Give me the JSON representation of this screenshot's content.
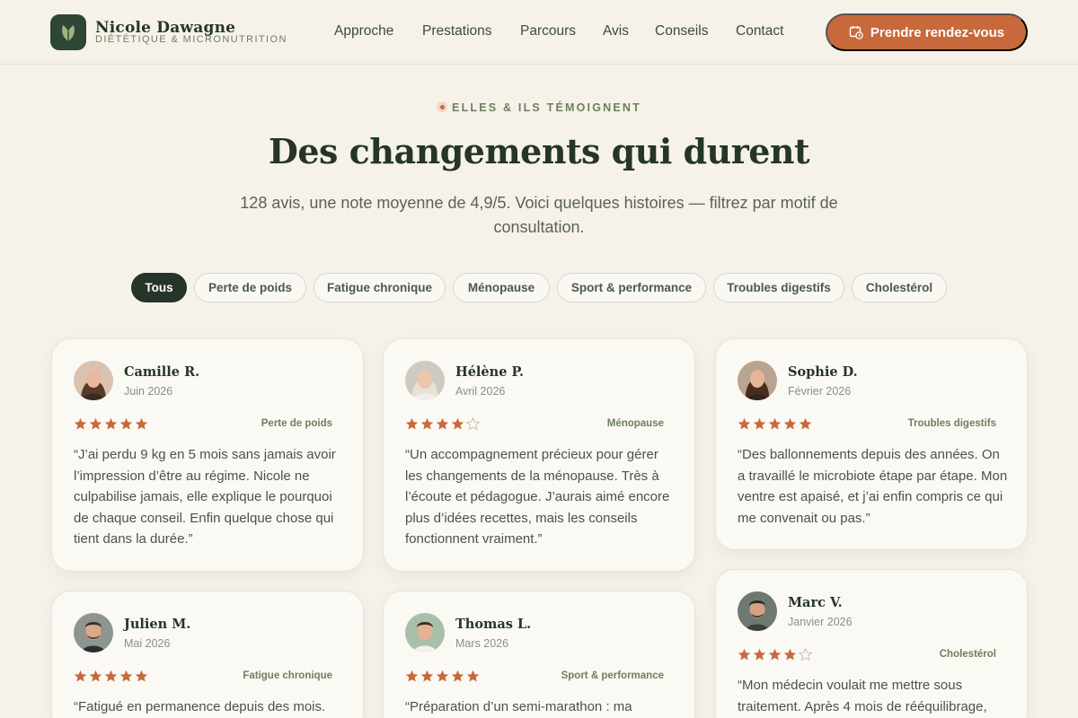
{
  "brand": {
    "name": "Nicole Dawagne",
    "tagline": "DIÉTÉTIQUE & MICRONUTRITION",
    "logo_icon": "leaf-icon"
  },
  "nav": {
    "items": [
      "Approche",
      "Prestations",
      "Parcours",
      "Avis",
      "Conseils",
      "Contact"
    ],
    "cta_label": "Prendre rendez-vous",
    "cta_icon": "calendar-clock-icon"
  },
  "hero": {
    "eyebrow": "ELLES & ILS TÉMOIGNENT",
    "title": "Des changements qui durent",
    "subtitle": "128 avis, une note moyenne de 4,9/5. Voici quelques histoires — filtrez par motif de consultation."
  },
  "filters": {
    "selected": "Tous",
    "options": [
      "Tous",
      "Perte de poids",
      "Fatigue chronique",
      "Ménopause",
      "Sport & performance",
      "Troubles digestifs",
      "Cholestérol"
    ]
  },
  "reviews": [
    {
      "name": "Camille R.",
      "date": "Juin 2026",
      "rating": 5,
      "tag": "Perte de poids",
      "text": "“J’ai perdu 9 kg en 5 mois sans jamais avoir l’impression d’être au régime. Nicole ne culpabilise jamais, elle explique le pourquoi de chaque conseil. Enfin quelque chose qui tient dans la durée.”"
    },
    {
      "name": "Hélène P.",
      "date": "Avril 2026",
      "rating": 4,
      "tag": "Ménopause",
      "text": "“Un accompagnement précieux pour gérer les changements de la ménopause. Très à l’écoute et pédagogue. J’aurais aimé encore plus d’idées recettes, mais les conseils fonctionnent vraiment.”"
    },
    {
      "name": "Sophie D.",
      "date": "Février 2026",
      "rating": 5,
      "tag": "Troubles digestifs",
      "text": "“Des ballonnements depuis des années. On a travaillé le microbiote étape par étape. Mon ventre est apaisé, et j’ai enfin compris ce qui me convenait ou pas.”"
    },
    {
      "name": "Julien M.",
      "date": "Mai 2026",
      "rating": 5,
      "tag": "Fatigue chronique",
      "text": "“Fatigué en permanence depuis des mois."
    },
    {
      "name": "Thomas L.",
      "date": "Mars 2026",
      "rating": 5,
      "tag": "Sport & performance",
      "text": "“Préparation d’un semi-marathon : ma"
    },
    {
      "name": "Marc V.",
      "date": "Janvier 2026",
      "rating": 4,
      "tag": "Cholestérol",
      "text": "“Mon médecin voulait me mettre sous traitement. Après 4 mois de rééquilibrage,"
    }
  ],
  "colors": {
    "accent": "#c8693c",
    "dark_green": "#25352a",
    "sage": "#6d7f5e",
    "background": "#f6f2ea",
    "star": "#c8693c"
  }
}
